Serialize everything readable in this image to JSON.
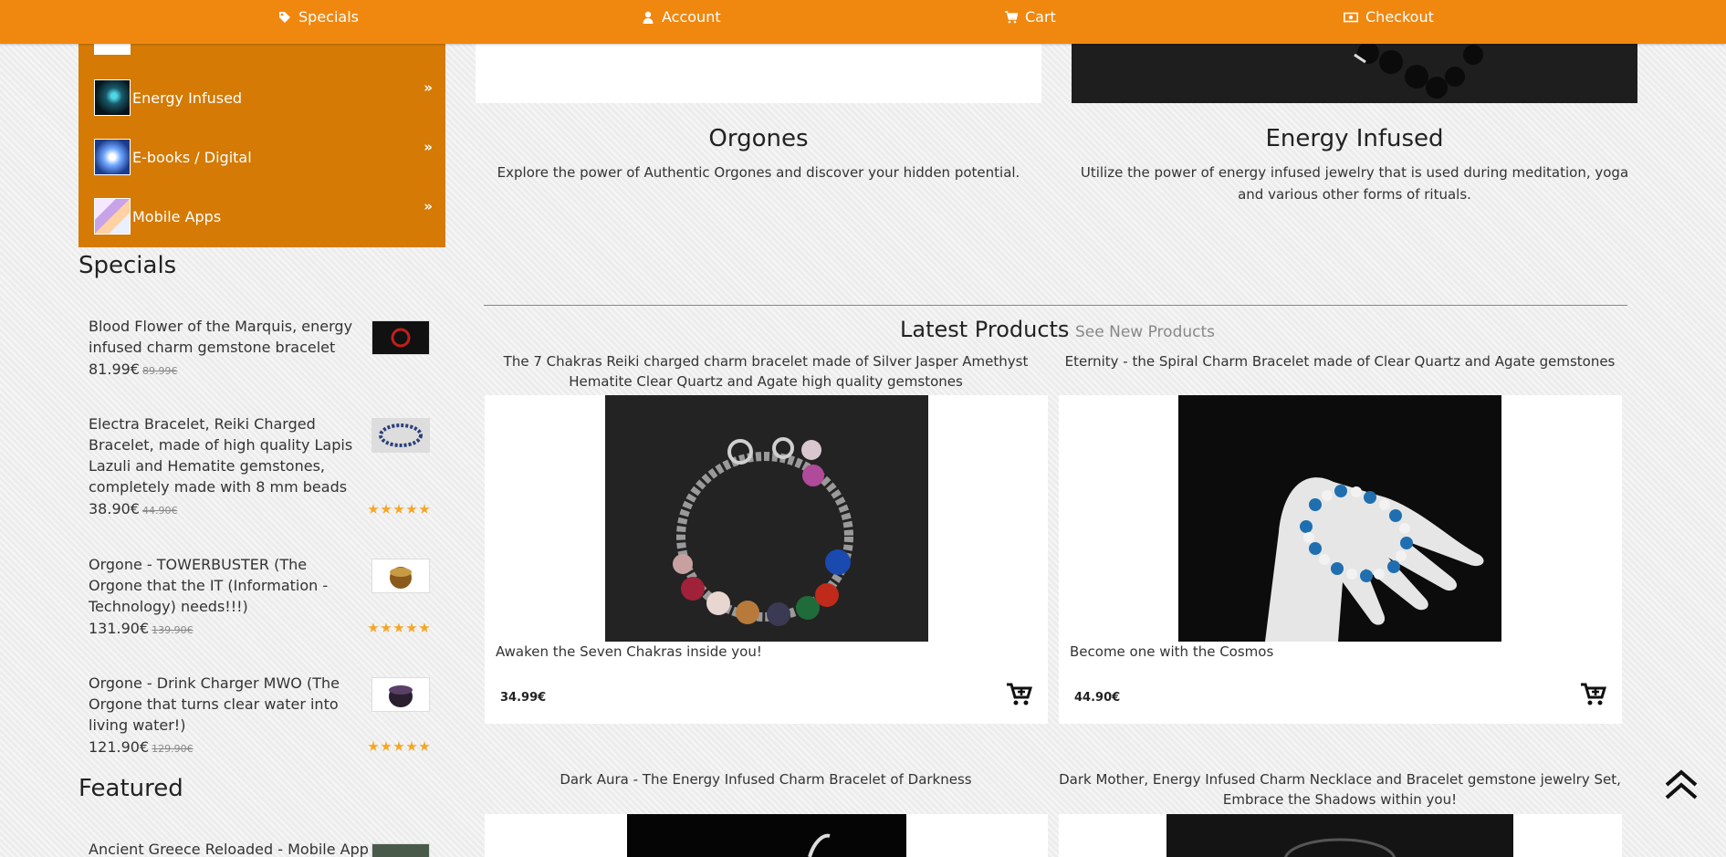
{
  "nav": {
    "specials": "Specials",
    "account": "Account",
    "cart": "Cart",
    "checkout": "Checkout"
  },
  "categories": [
    {
      "label": "Energy Infused",
      "arrow": "»"
    },
    {
      "label": "E-books / Digital",
      "arrow": "»"
    },
    {
      "label": "Mobile Apps",
      "arrow": "»"
    }
  ],
  "specials": {
    "heading": "Specials",
    "items": [
      {
        "title": "Blood Flower of the Marquis, energy infused charm gemstone bracelet",
        "price": "81.99€",
        "old_price": "89.99€"
      },
      {
        "title": "Electra Bracelet, Reiki Charged Bracelet, made of high quality Lapis Lazuli and Hematite gemstones, completely made with 8 mm beads",
        "price": "38.90€",
        "old_price": "44.90€",
        "rating": 5
      },
      {
        "title": "Orgone - TOWERBUSTER (The Orgone that the IT (Information - Technology) needs!!!)",
        "price": "131.90€",
        "old_price": "139.90€",
        "rating": 5
      },
      {
        "title": "Orgone - Drink Charger MWO (The Orgone that turns clear water into living water!)",
        "price": "121.90€",
        "old_price": "129.90€",
        "rating": 5
      }
    ]
  },
  "featured": {
    "heading": "Featured",
    "items": [
      {
        "title": "Ancient Greece Reloaded - Mobile App"
      }
    ]
  },
  "category_panels": [
    {
      "title": "Orgones",
      "desc": "Explore the power of Authentic Orgones and discover your hidden potential."
    },
    {
      "title": "Energy Infused",
      "desc": "Utilize the power of energy infused jewelry that is used during meditation, yoga and various other forms of rituals."
    }
  ],
  "latest": {
    "heading": "Latest Products",
    "see_new": "See New Products",
    "products": [
      {
        "title": "The 7 Chakras Reiki charged charm bracelet made of Silver Jasper Amethyst Hematite Clear Quartz and Agate high quality gemstones",
        "tagline": "Awaken the Seven Chakras inside you!",
        "price": "34.99€"
      },
      {
        "title": "Eternity - the Spiral Charm Bracelet made of Clear Quartz and Agate gemstones",
        "tagline": "Become one with the Cosmos",
        "price": "44.90€"
      },
      {
        "title": "Dark Aura - The Energy Infused Charm Bracelet of Darkness"
      },
      {
        "title": "Dark Mother, Energy Infused Charm Necklace and Bracelet gemstone jewelry Set, Embrace the Shadows within you!"
      }
    ]
  },
  "colors": {
    "nav_bg": "#f0870f",
    "category_bg": "#d47a05",
    "star": "#f5a623"
  }
}
